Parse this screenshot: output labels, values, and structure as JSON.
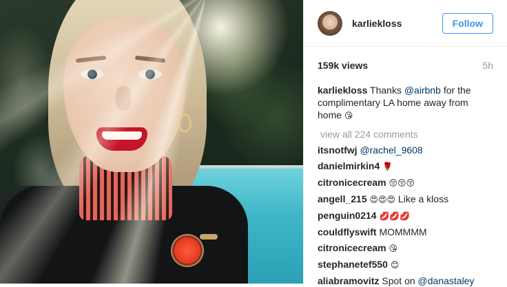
{
  "post": {
    "username": "karliekloss",
    "follow_label": "Follow",
    "views": "159k views",
    "age": "5h",
    "caption": {
      "user": "karliekloss",
      "text_before": "Thanks ",
      "mention": "@airbnb",
      "text_after": " for the complimentary LA home away from home",
      "emoji_name": "kissing-face-emoji"
    },
    "view_all_label": "view all 224 comments"
  },
  "comments": [
    {
      "user": "itsnotfwj",
      "mention": "@rachel_9608",
      "text": "",
      "emoji": []
    },
    {
      "user": "danielmirkin4",
      "mention": "",
      "text": "",
      "emoji": [
        "rose"
      ]
    },
    {
      "user": "citronicecream",
      "mention": "",
      "text": "",
      "emoji": [
        "kissing-face",
        "kissing-face",
        "kissing-face"
      ]
    },
    {
      "user": "angell_215",
      "mention": "",
      "text": "Like a kloss",
      "emoji": [
        "heart-eyes",
        "heart-eyes",
        "heart-eyes"
      ]
    },
    {
      "user": "penguin0214",
      "mention": "",
      "text": "",
      "emoji": [
        "lips",
        "lips",
        "lips"
      ]
    },
    {
      "user": "couldflyswift",
      "mention": "",
      "text": "MOMMMM",
      "emoji": []
    },
    {
      "user": "citronicecream",
      "mention": "",
      "text": "",
      "emoji": [
        "kissing-face"
      ]
    },
    {
      "user": "stephanetef550",
      "mention": "",
      "text": "",
      "emoji": [
        "smile"
      ]
    },
    {
      "user": "aliabramovitz",
      "mention": "@danastaley",
      "text": "Spot on ",
      "emoji": []
    }
  ],
  "colors": {
    "accent": "#3897f0",
    "mention": "#003569",
    "muted": "#999999",
    "text": "#262626"
  }
}
